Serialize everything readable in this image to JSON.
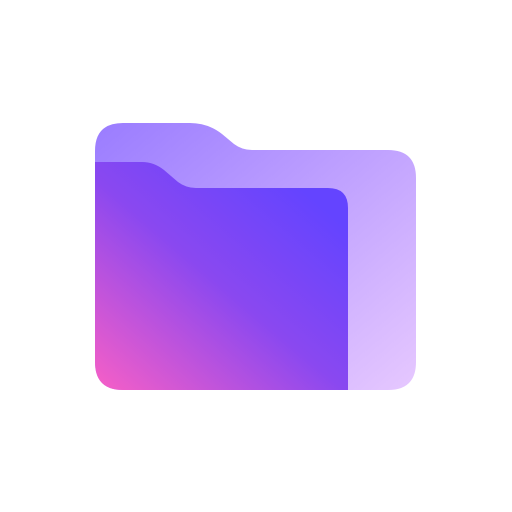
{
  "icon": {
    "name": "folder-icon",
    "background_color": "#ffffff",
    "colors": {
      "back_panel_top": "#9a7cff",
      "back_panel_mid": "#c4a6ff",
      "back_panel_bottom": "#e6c8ff",
      "front_panel_top_right": "#6444ff",
      "front_panel_mid": "#8a48f0",
      "front_panel_bottom_left": "#f25ec8"
    }
  }
}
